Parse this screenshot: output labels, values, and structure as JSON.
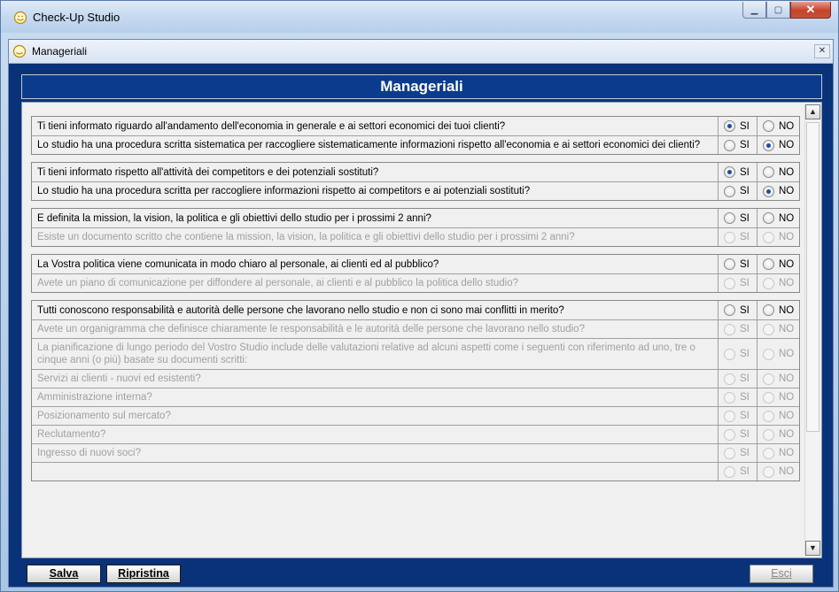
{
  "window": {
    "title": "Check-Up Studio"
  },
  "inner": {
    "title": "Manageriali",
    "header": "Manageriali"
  },
  "groups": [
    {
      "rows": [
        {
          "text": "Ti tieni informato riguardo all'andamento dell'economia in generale e ai settori economici dei tuoi clienti?",
          "si": "SI",
          "no": "NO",
          "selected": "si",
          "enabled": true
        },
        {
          "text": "Lo studio ha una procedura scritta sistematica per raccogliere sistematicamente informazioni rispetto all'economia e ai settori economici dei clienti?",
          "si": "SI",
          "no": "NO",
          "selected": "no",
          "enabled": true
        }
      ]
    },
    {
      "rows": [
        {
          "text": "Ti tieni informato rispetto all'attività dei competitors e dei potenziali sostituti?",
          "si": "SI",
          "no": "NO",
          "selected": "si",
          "enabled": true
        },
        {
          "text": "Lo studio ha una procedura scritta per raccogliere informazioni rispetto ai competitors e ai potenziali sostituti?",
          "si": "SI",
          "no": "NO",
          "selected": "no",
          "enabled": true
        }
      ]
    },
    {
      "rows": [
        {
          "text": "E definita la mission, la vision, la politica e gli obiettivi dello studio per i prossimi 2 anni?",
          "si": "SI",
          "no": "NO",
          "selected": "",
          "enabled": true
        },
        {
          "text": "Esiste un documento scritto che contiene la mission, la vision, la politica e gli obiettivi dello studio per i prossimi 2 anni?",
          "si": "SI",
          "no": "NO",
          "selected": "",
          "enabled": false
        }
      ]
    },
    {
      "rows": [
        {
          "text": "La Vostra politica viene comunicata in modo chiaro al personale, ai clienti ed al pubblico?",
          "si": "SI",
          "no": "NO",
          "selected": "",
          "enabled": true
        },
        {
          "text": "Avete un piano di comunicazione per diffondere al personale, ai clienti e al pubblico la politica dello studio?",
          "si": "SI",
          "no": "NO",
          "selected": "",
          "enabled": false
        }
      ]
    },
    {
      "rows": [
        {
          "text": "Tutti conoscono responsabilità e autorità delle persone che lavorano nello studio e non ci sono mai conflitti in merito?",
          "si": "SI",
          "no": "NO",
          "selected": "",
          "enabled": true
        },
        {
          "text": "Avete un organigramma che definisce chiaramente le responsabilità e le autorità delle persone che lavorano nello studio?",
          "si": "SI",
          "no": "NO",
          "selected": "",
          "enabled": false
        },
        {
          "text": "La pianificazione di lungo periodo del Vostro Studio include delle valutazioni relative ad alcuni aspetti come i seguenti con riferimento ad uno, tre o cinque anni (o più) basate su documenti scritti:",
          "si": "SI",
          "no": "NO",
          "selected": "",
          "enabled": false
        },
        {
          "text": "Servizi ai clienti - nuovi ed esistenti?",
          "si": "SI",
          "no": "NO",
          "selected": "",
          "enabled": false
        },
        {
          "text": "Amministrazione interna?",
          "si": "SI",
          "no": "NO",
          "selected": "",
          "enabled": false
        },
        {
          "text": "Posizionamento sul mercato?",
          "si": "SI",
          "no": "NO",
          "selected": "",
          "enabled": false
        },
        {
          "text": "Reclutamento?",
          "si": "SI",
          "no": "NO",
          "selected": "",
          "enabled": false
        },
        {
          "text": "Ingresso di nuovi soci?",
          "si": "SI",
          "no": "NO",
          "selected": "",
          "enabled": false
        },
        {
          "text": "",
          "si": "SI",
          "no": "NO",
          "selected": "",
          "enabled": false
        }
      ]
    }
  ],
  "buttons": {
    "save": "Salva",
    "restore": "Ripristina",
    "exit": "Esci"
  }
}
